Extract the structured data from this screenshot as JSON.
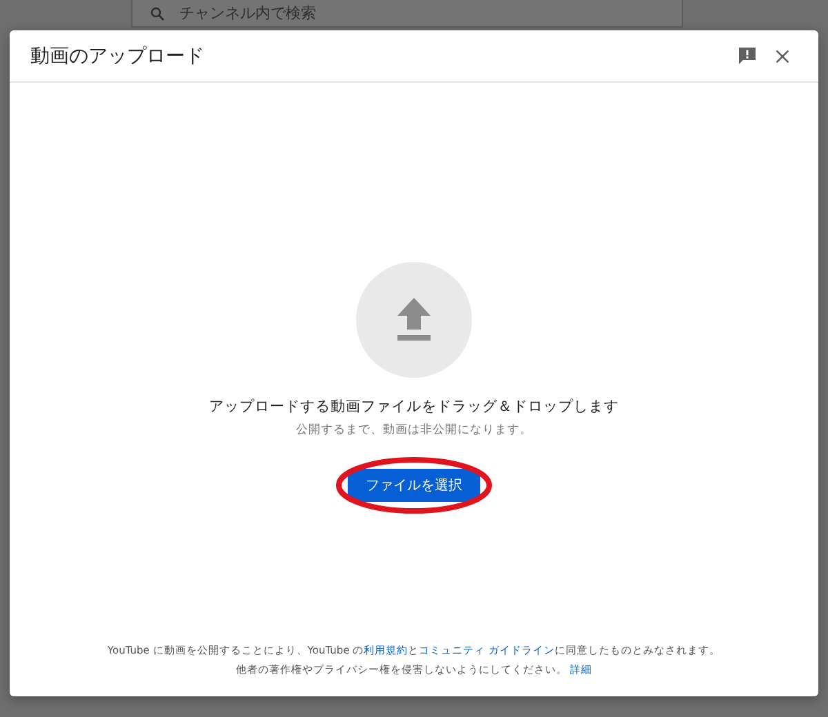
{
  "background_page": {
    "search": {
      "placeholder": "チャンネル内で検索"
    }
  },
  "dialog": {
    "title": "動画のアップロード",
    "drop_zone": {
      "heading": "アップロードする動画ファイルをドラッグ＆ドロップします",
      "note": "公開するまで、動画は非公開になります。"
    },
    "select_button": {
      "label": "ファイルを選択",
      "circled": true
    },
    "footer": [
      [
        {
          "kind": "text",
          "text": "YouTube に動画を公開することにより、YouTube の"
        },
        {
          "kind": "link",
          "text": "利用規約"
        },
        {
          "kind": "text",
          "text": "と"
        },
        {
          "kind": "link",
          "text": "コミュニティ ガイドライン"
        },
        {
          "kind": "text",
          "text": "に同意したものとみなされます。"
        }
      ],
      [
        {
          "kind": "text",
          "text": "他者の著作権やプライバシー権を侵害しないようにしてください。 "
        },
        {
          "kind": "link",
          "text": "詳細"
        }
      ]
    ]
  }
}
